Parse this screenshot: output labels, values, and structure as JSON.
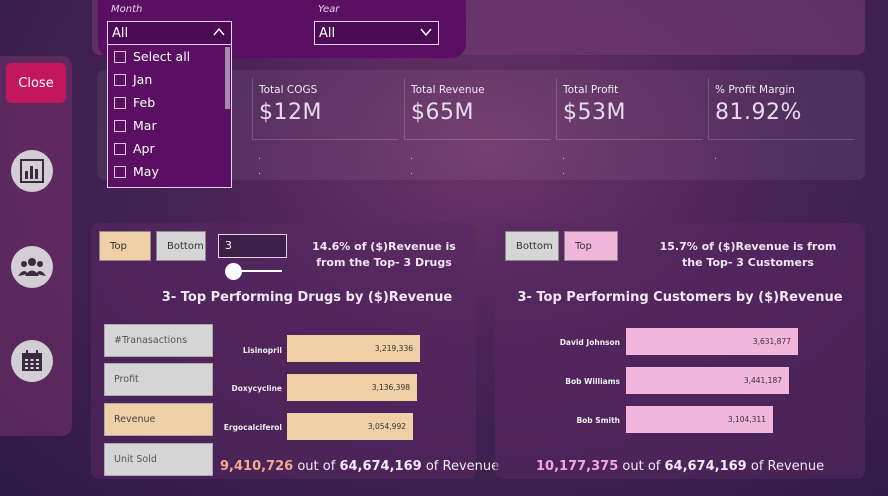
{
  "filters": {
    "month": {
      "label": "Month",
      "value": "All"
    },
    "year": {
      "label": "Year",
      "value": "All"
    },
    "month_options": [
      "Select all",
      "Jan",
      "Feb",
      "Mar",
      "Apr",
      "May"
    ]
  },
  "nav": {
    "close_label": "Close",
    "icons": [
      "dashboard-chart-icon",
      "customers-group-icon",
      "calendar-icon"
    ]
  },
  "kpis": [
    {
      "label": "Total COGS",
      "value": "$12M"
    },
    {
      "label": "Total Revenue",
      "value": "$65M"
    },
    {
      "label": "Total Profit",
      "value": "$53M"
    },
    {
      "label": "% Profit Margin",
      "value": "81.92%"
    }
  ],
  "drugs_panel": {
    "toggle_top": "Top",
    "toggle_bottom": "Bottom",
    "n_input": "3",
    "pct_text": "14.6% of ($)Revenue is from the Top- 3 Drugs",
    "title": "3- Top Performing Drugs by ($)Revenue",
    "metrics": [
      "#Tranasactions",
      "Profit",
      "Revenue",
      "Unit Sold"
    ],
    "active_metric": "Revenue",
    "summary_value": "9,410,726",
    "summary_mid": "out of",
    "summary_total": "64,674,169",
    "summary_tail": "of Revenue"
  },
  "customers_panel": {
    "toggle_bottom": "Bottom",
    "toggle_top": "Top",
    "pct_text": "15.7% of ($)Revenue is from the Top- 3 Customers",
    "title": "3- Top Performing Customers by ($)Revenue",
    "summary_value": "10,177,375",
    "summary_mid": "out of",
    "summary_total": "64,674,169",
    "summary_tail": "of Revenue"
  },
  "colors": {
    "drug_bar": "#f0cfa6",
    "customer_bar": "#f2b6dc",
    "accent_pink": "#c2185b",
    "drug_summary": "#f4a98a",
    "customer_summary": "#f0a8dc"
  },
  "chart_data": [
    {
      "type": "bar",
      "orientation": "horizontal",
      "title": "3- Top Performing Drugs by ($)Revenue",
      "categories": [
        "Lisinopril",
        "Doxycycline",
        "Ergocalciferol"
      ],
      "values": [
        3219336,
        3136398,
        3054992
      ],
      "labels": [
        "3,219,336",
        "3,136,398",
        "3,054,992"
      ]
    },
    {
      "type": "bar",
      "orientation": "horizontal",
      "title": "3- Top Performing Customers by ($)Revenue",
      "categories": [
        "David Johnson",
        "Bob Williams",
        "Bob Smith"
      ],
      "values": [
        3631877,
        3441187,
        3104311
      ],
      "labels": [
        "3,631,877",
        "3,441,187",
        "3,104,311"
      ]
    }
  ]
}
